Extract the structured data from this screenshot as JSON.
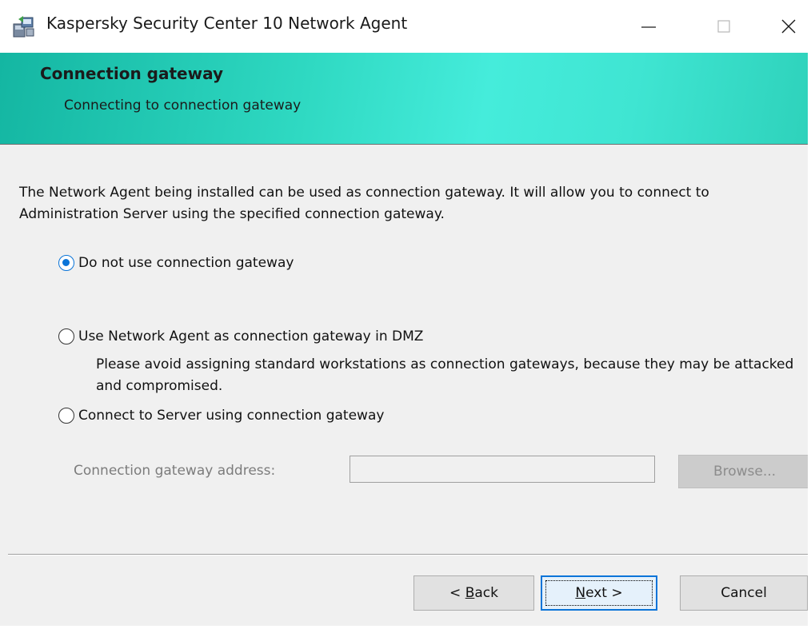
{
  "window": {
    "title": "Kaspersky Security Center 10 Network Agent",
    "controls": {
      "minimize": "minimize-icon",
      "maximize": "maximize-icon",
      "close": "close-icon"
    }
  },
  "header": {
    "title": "Connection gateway",
    "subtitle": "Connecting to connection gateway",
    "colors": {
      "gradient_start": "#14b6a2",
      "gradient_mid": "#45ecdb",
      "gradient_end": "#2ed2bb"
    }
  },
  "main": {
    "description": "The Network Agent being installed can be used as connection gateway. It will allow you to connect to Administration Server using the specified connection gateway.",
    "options": [
      {
        "label": "Do not use connection gateway",
        "selected": true
      },
      {
        "label": "Use Network Agent as connection gateway in DMZ",
        "selected": false
      },
      {
        "label": "Connect to Server using connection gateway",
        "selected": false
      }
    ],
    "dmz_note": "Please avoid assigning standard workstations as connection gateways, because they may be attacked and compromised.",
    "address": {
      "label": "Connection gateway address:",
      "value": "",
      "enabled": false
    },
    "browse_label": "Browse..."
  },
  "footer": {
    "back": {
      "prefix": "< ",
      "mnemonic": "B",
      "rest": "ack"
    },
    "next": {
      "mnemonic": "N",
      "rest": "ext >"
    },
    "cancel": "Cancel"
  },
  "colors": {
    "accent": "#0a74d8",
    "dialog_background": "#f0f0f0"
  }
}
